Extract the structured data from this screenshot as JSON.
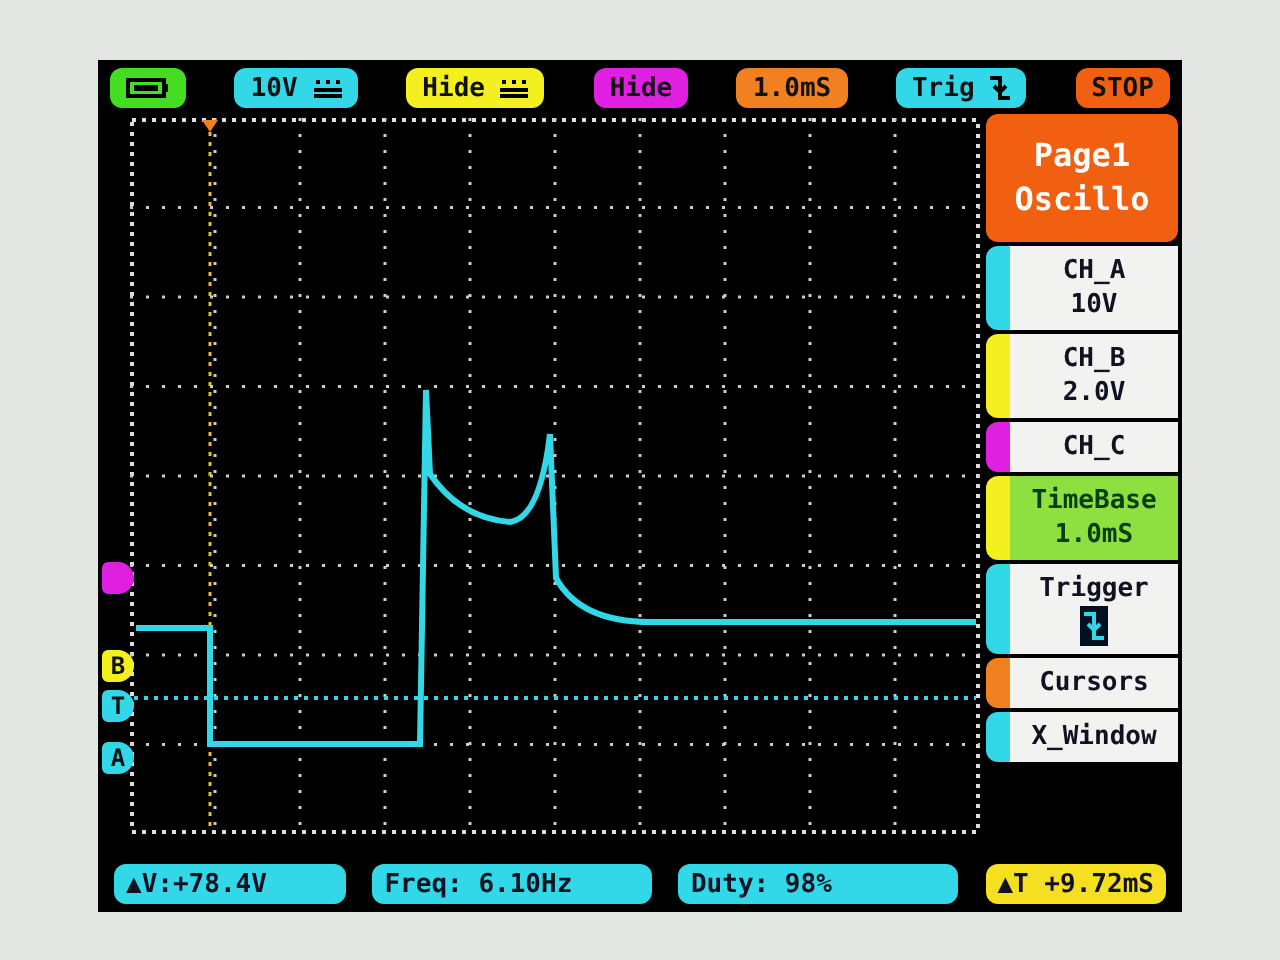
{
  "top_bar": [
    {
      "kind": "battery",
      "color": "#44dd22"
    },
    {
      "kind": "text",
      "label": "10V",
      "icon": true,
      "color": "#33d8e8"
    },
    {
      "kind": "text",
      "label": "Hide",
      "icon": true,
      "color": "#f4f020"
    },
    {
      "kind": "text",
      "label": "Hide",
      "icon": false,
      "color": "#e020e0"
    },
    {
      "kind": "text",
      "label": "1.0mS",
      "icon": false,
      "color": "#f08020"
    },
    {
      "kind": "trig",
      "label": "Trig",
      "color": "#33d8e8"
    },
    {
      "kind": "text",
      "label": "STOP",
      "icon": false,
      "color": "#f06010"
    }
  ],
  "plot": {
    "markers": [
      {
        "color": "#e020e0"
      },
      {
        "label": "B",
        "color": "#f4f020"
      },
      {
        "label": "T",
        "color": "#33d8e8"
      },
      {
        "label": "A",
        "color": "#33d8e8"
      }
    ]
  },
  "side_menu": [
    {
      "kind": "title",
      "lines": [
        "Page1",
        "Oscillo"
      ],
      "color": "#f06010"
    },
    {
      "kind": "item",
      "lines": [
        "CH_A",
        "10V"
      ],
      "selected": false,
      "color": "#33d8e8"
    },
    {
      "kind": "item",
      "lines": [
        "CH_B",
        "2.0V"
      ],
      "selected": false,
      "color": "#f4f020"
    },
    {
      "kind": "item",
      "lines": [
        "CH_C"
      ],
      "selected": false,
      "color": "#e020e0"
    },
    {
      "kind": "item",
      "lines": [
        "TimeBase",
        "1.0mS"
      ],
      "selected": true,
      "color": "#f4f020"
    },
    {
      "kind": "trigger",
      "lines": [
        "Trigger"
      ],
      "selected": false,
      "color": "#33d8e8"
    },
    {
      "kind": "item",
      "lines": [
        "Cursors"
      ],
      "selected": false,
      "color": "#f08020"
    },
    {
      "kind": "item",
      "lines": [
        "X_Window"
      ],
      "selected": false,
      "color": "#33d8e8"
    }
  ],
  "bottom_bar": [
    {
      "label": "▲V:+78.4V",
      "color": "#33d8e8"
    },
    {
      "label": "Freq: 6.10Hz",
      "color": "#33d8e8"
    },
    {
      "label": "Duty: 98%",
      "color": "#33d8e8"
    },
    {
      "label": "▲T +9.72mS",
      "color": "#f4e020"
    }
  ]
}
